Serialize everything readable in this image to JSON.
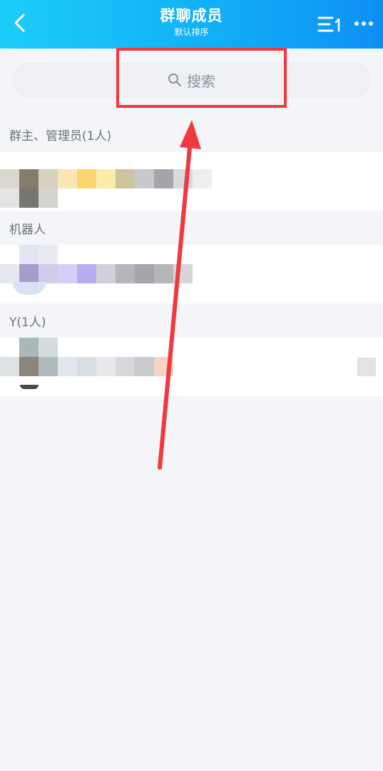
{
  "header": {
    "title": "群聊成员",
    "subtitle": "默认排序",
    "back_icon": "chevron-left-icon",
    "sort_icon": "sort-list-icon",
    "more_icon": "more-dots-icon"
  },
  "search": {
    "label": "搜索",
    "icon": "search-icon"
  },
  "sections": {
    "owner_admin": "群主、管理员(1人)",
    "bots": "机器人",
    "y_group": "Y(1人)"
  },
  "colors": {
    "header_start": "#1ccdf8",
    "header_end": "#0d8ff5",
    "annotation": "#f0383f",
    "background": "#f4f5f9"
  }
}
